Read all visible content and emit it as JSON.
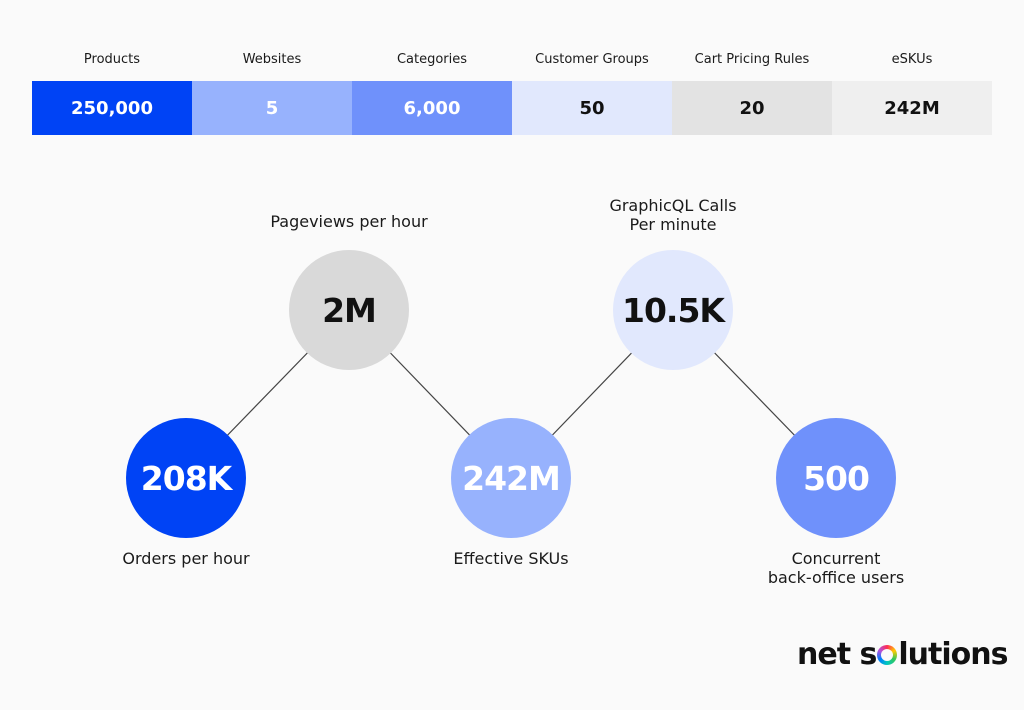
{
  "stats": [
    {
      "label": "Products",
      "value": "250,000",
      "bg": "#0043f5",
      "fg": "#ffffff"
    },
    {
      "label": "Websites",
      "value": "5",
      "bg": "#97b2fd",
      "fg": "#ffffff"
    },
    {
      "label": "Categories",
      "value": "6,000",
      "bg": "#6f91fb",
      "fg": "#ffffff"
    },
    {
      "label": "Customer Groups",
      "value": "50",
      "bg": "#e1e8fd",
      "fg": "#111111"
    },
    {
      "label": "Cart Pricing Rules",
      "value": "20",
      "bg": "#e3e3e3",
      "fg": "#111111"
    },
    {
      "label": "eSKUs",
      "value": "242M",
      "bg": "#efefef",
      "fg": "#111111"
    }
  ],
  "metrics": [
    {
      "id": "orders",
      "value": "208K",
      "caption": "Orders per hour",
      "caption_position": "below",
      "bg": "#0043f5",
      "fg": "#ffffff"
    },
    {
      "id": "pageviews",
      "value": "2M",
      "caption": "Pageviews per hour",
      "caption_position": "above",
      "bg": "#d9d9d9",
      "fg": "#111111"
    },
    {
      "id": "skus",
      "value": "242M",
      "caption": "Effective SKUs",
      "caption_position": "below",
      "bg": "#97b2fd",
      "fg": "#ffffff"
    },
    {
      "id": "graphql",
      "value": "10.5K",
      "caption_line1": "GraphicQL Calls",
      "caption_line2": "Per minute",
      "caption_position": "above",
      "bg": "#e1e8fd",
      "fg": "#111111"
    },
    {
      "id": "backoffice",
      "value": "500",
      "caption_line1": "Concurrent",
      "caption_line2": "back-office users",
      "caption_position": "below",
      "bg": "#6f91fb",
      "fg": "#ffffff"
    }
  ],
  "brand": {
    "part1": "net s",
    "part2": "lutions"
  }
}
